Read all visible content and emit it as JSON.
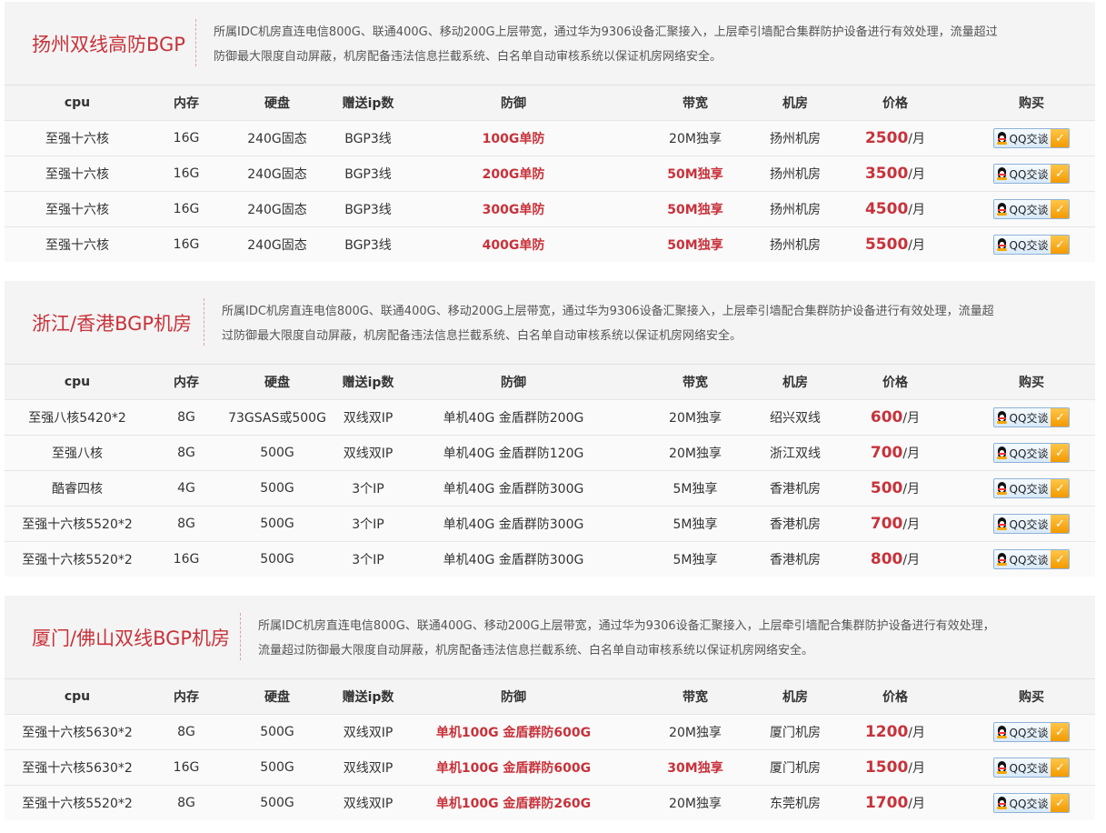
{
  "columns": [
    "cpu",
    "内存",
    "硬盘",
    "赠送ip数",
    "防御",
    "带宽",
    "机房",
    "价格",
    "购买"
  ],
  "button": {
    "label": "QQ交谈",
    "icon": "qq-penguin-icon",
    "check_icon": "check-icon"
  },
  "colors": {
    "accent": "#c8323a",
    "button_blue": "#d8e9f8",
    "button_orange": "#f29a00"
  },
  "sections": [
    {
      "title": "扬州双线高防BGP",
      "desc_lines": [
        "所属IDC机房直连电信800G、联通400G、移动200G上层带宽，通过华为9306设备汇聚接入，上层牵引墙配合集群防护设备进行有效处理，流量超过",
        "防御最大限度自动屏蔽，机房配备违法信息拦截系统、白名单自动审核系统以保证机房网络安全。"
      ],
      "rows": [
        {
          "cpu": "至强十六核",
          "mem": "16G",
          "disk": "240G固态",
          "ip": "BGP3线",
          "defense": "100G单防",
          "defense_red": true,
          "bw": "20M独享",
          "bw_red": false,
          "room": "扬州机房",
          "price": "2500",
          "unit": "/月"
        },
        {
          "cpu": "至强十六核",
          "mem": "16G",
          "disk": "240G固态",
          "ip": "BGP3线",
          "defense": "200G单防",
          "defense_red": true,
          "bw": "50M独享",
          "bw_red": true,
          "room": "扬州机房",
          "price": "3500",
          "unit": "/月"
        },
        {
          "cpu": "至强十六核",
          "mem": "16G",
          "disk": "240G固态",
          "ip": "BGP3线",
          "defense": "300G单防",
          "defense_red": true,
          "bw": "50M独享",
          "bw_red": true,
          "room": "扬州机房",
          "price": "4500",
          "unit": "/月"
        },
        {
          "cpu": "至强十六核",
          "mem": "16G",
          "disk": "240G固态",
          "ip": "BGP3线",
          "defense": "400G单防",
          "defense_red": true,
          "bw": "50M独享",
          "bw_red": true,
          "room": "扬州机房",
          "price": "5500",
          "unit": "/月"
        }
      ]
    },
    {
      "title": "浙江/香港BGP机房",
      "desc_lines": [
        "所属IDC机房直连电信800G、联通400G、移动200G上层带宽，通过华为9306设备汇聚接入，上层牵引墙配合集群防护设备进行有效处理，流量超",
        "过防御最大限度自动屏蔽，机房配备违法信息拦截系统、白名单自动审核系统以保证机房网络安全。"
      ],
      "rows": [
        {
          "cpu": "至强八核5420*2",
          "mem": "8G",
          "disk": "73GSAS或500G",
          "ip": "双线双IP",
          "defense": "单机40G 金盾群防200G",
          "defense_red": false,
          "bw": "20M独享",
          "bw_red": false,
          "room": "绍兴双线",
          "price": "600",
          "unit": "/月"
        },
        {
          "cpu": "至强八核",
          "mem": "8G",
          "disk": "500G",
          "ip": "双线双IP",
          "defense": "单机40G 金盾群防120G",
          "defense_red": false,
          "bw": "20M独享",
          "bw_red": false,
          "room": "浙江双线",
          "price": "700",
          "unit": "/月"
        },
        {
          "cpu": "酷睿四核",
          "mem": "4G",
          "disk": "500G",
          "ip": "3个IP",
          "defense": "单机40G 金盾群防300G",
          "defense_red": false,
          "bw": "5M独享",
          "bw_red": false,
          "room": "香港机房",
          "price": "500",
          "unit": "/月"
        },
        {
          "cpu": "至强十六核5520*2",
          "mem": "8G",
          "disk": "500G",
          "ip": "3个IP",
          "defense": "单机40G 金盾群防300G",
          "defense_red": false,
          "bw": "5M独享",
          "bw_red": false,
          "room": "香港机房",
          "price": "700",
          "unit": "/月"
        },
        {
          "cpu": "至强十六核5520*2",
          "mem": "16G",
          "disk": "500G",
          "ip": "3个IP",
          "defense": "单机40G 金盾群防300G",
          "defense_red": false,
          "bw": "5M独享",
          "bw_red": false,
          "room": "香港机房",
          "price": "800",
          "unit": "/月"
        }
      ]
    },
    {
      "title": "厦门/佛山双线BGP机房",
      "desc_lines": [
        "所属IDC机房直连电信800G、联通400G、移动200G上层带宽，通过华为9306设备汇聚接入，上层牵引墙配合集群防护设备进行有效处理，",
        "流量超过防御最大限度自动屏蔽，机房配备违法信息拦截系统、白名单自动审核系统以保证机房网络安全。"
      ],
      "rows": [
        {
          "cpu": "至强十六核5630*2",
          "mem": "8G",
          "disk": "500G",
          "ip": "双线双IP",
          "defense": "单机100G 金盾群防600G",
          "defense_red": true,
          "bw": "20M独享",
          "bw_red": false,
          "room": "厦门机房",
          "price": "1200",
          "unit": "/月"
        },
        {
          "cpu": "至强十六核5630*2",
          "mem": "16G",
          "disk": "500G",
          "ip": "双线双IP",
          "defense": "单机100G 金盾群防600G",
          "defense_red": true,
          "bw": "30M独享",
          "bw_red": true,
          "room": "厦门机房",
          "price": "1500",
          "unit": "/月"
        },
        {
          "cpu": "至强十六核5520*2",
          "mem": "8G",
          "disk": "500G",
          "ip": "双线双IP",
          "defense": "单机100G 金盾群防260G",
          "defense_red": true,
          "bw": "20M独享",
          "bw_red": false,
          "room": "东莞机房",
          "price": "1700",
          "unit": "/月"
        }
      ]
    }
  ]
}
